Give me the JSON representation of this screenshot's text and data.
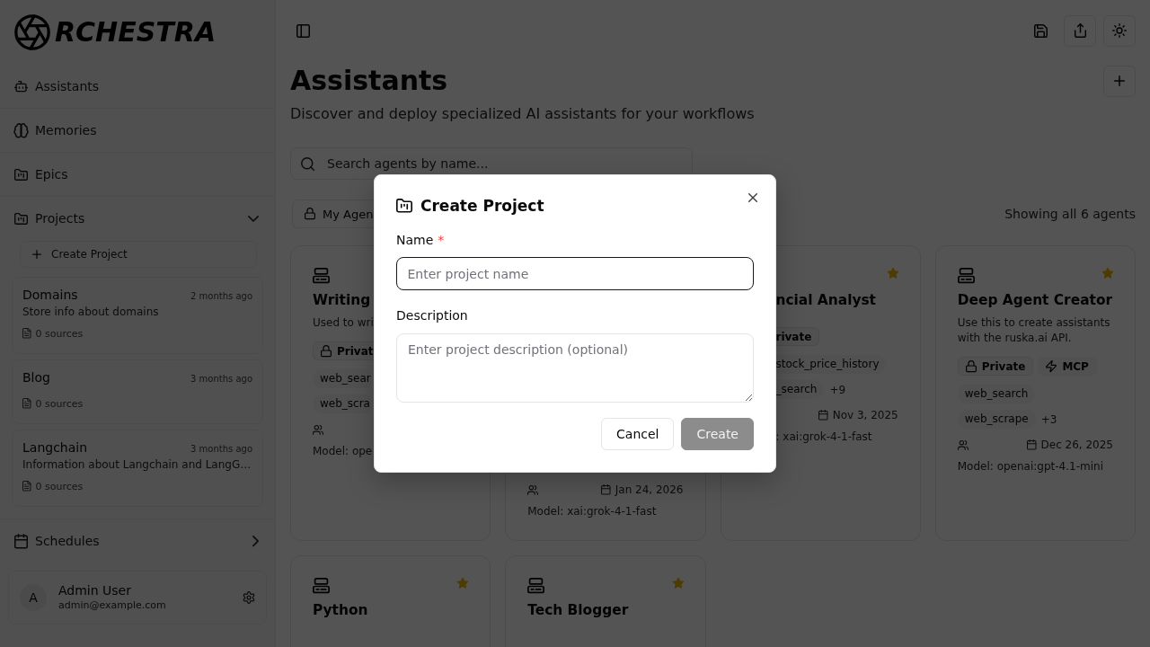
{
  "sidebar": {
    "logo_text": "RCHESTRA",
    "nav": [
      {
        "label": "Assistants"
      },
      {
        "label": "Memories"
      },
      {
        "label": "Epics"
      },
      {
        "label": "Projects",
        "expanded": true
      }
    ],
    "create_project": "Create Project",
    "projects": [
      {
        "name": "Domains",
        "updated": "2 months ago",
        "description": "Store info about domains",
        "sources": "0 sources"
      },
      {
        "name": "Blog",
        "updated": "3 months ago",
        "sources": "0 sources"
      },
      {
        "name": "Langchain",
        "updated": "3 months ago",
        "description": "Information about Langchain and LangG…",
        "sources": "0 sources"
      }
    ],
    "schedules": {
      "label": "Schedules",
      "expanded": false
    },
    "user": {
      "initial": "A",
      "name": "Admin User",
      "email": "admin@example.com"
    }
  },
  "main": {
    "title": "Assistants",
    "subtitle": "Discover and deploy specialized AI assistants for your workflows",
    "search": {
      "placeholder": "Search agents by name..."
    },
    "filter": "My Agen",
    "count": "Showing all 6 agents",
    "cards": [
      {
        "title": "Writing",
        "description": "Used to wri",
        "badges": [
          {
            "kind": "private",
            "label": "Privat"
          }
        ],
        "tools": [
          "web_sear",
          "web_scra"
        ],
        "model": "Model: ope"
      },
      {
        "date": "Jan 24, 2026",
        "model": "Model: xai:grok-4-1-fast"
      },
      {
        "title": "ncial Analyst",
        "starred": true,
        "badges": [
          {
            "kind": "plain",
            "label": "rivate"
          }
        ],
        "tools": [
          "stock_price_history",
          "_search"
        ],
        "more": "+9",
        "date": "Nov 3, 2025",
        "model": ": xai:grok-4-1-fast"
      },
      {
        "title": "Deep Agent Creator",
        "starred": true,
        "description": "Use this to create assistants with the ruska.ai API.",
        "badges": [
          {
            "kind": "private",
            "label": "Private"
          },
          {
            "kind": "mcp",
            "label": "MCP"
          }
        ],
        "tools": [
          "web_search",
          "web_scrape"
        ],
        "more": "+3",
        "date": "Dec 26, 2025",
        "model": "Model: openai:gpt-4.1-mini"
      },
      {
        "title": "Python",
        "starred": true
      },
      {
        "title": "Tech Blogger",
        "starred": true
      }
    ]
  },
  "dialog": {
    "title": "Create Project",
    "fields": [
      {
        "kind": "input",
        "label": "Name",
        "required_mark": "*",
        "placeholder": "Enter project name",
        "focused": true
      },
      {
        "kind": "textarea",
        "label": "Description",
        "placeholder": "Enter project description (optional)",
        "focused": false
      }
    ],
    "buttons": [
      {
        "kind": "cancel",
        "label": "Cancel",
        "disabled": false
      },
      {
        "kind": "submit",
        "label": "Create",
        "disabled": true
      }
    ]
  }
}
